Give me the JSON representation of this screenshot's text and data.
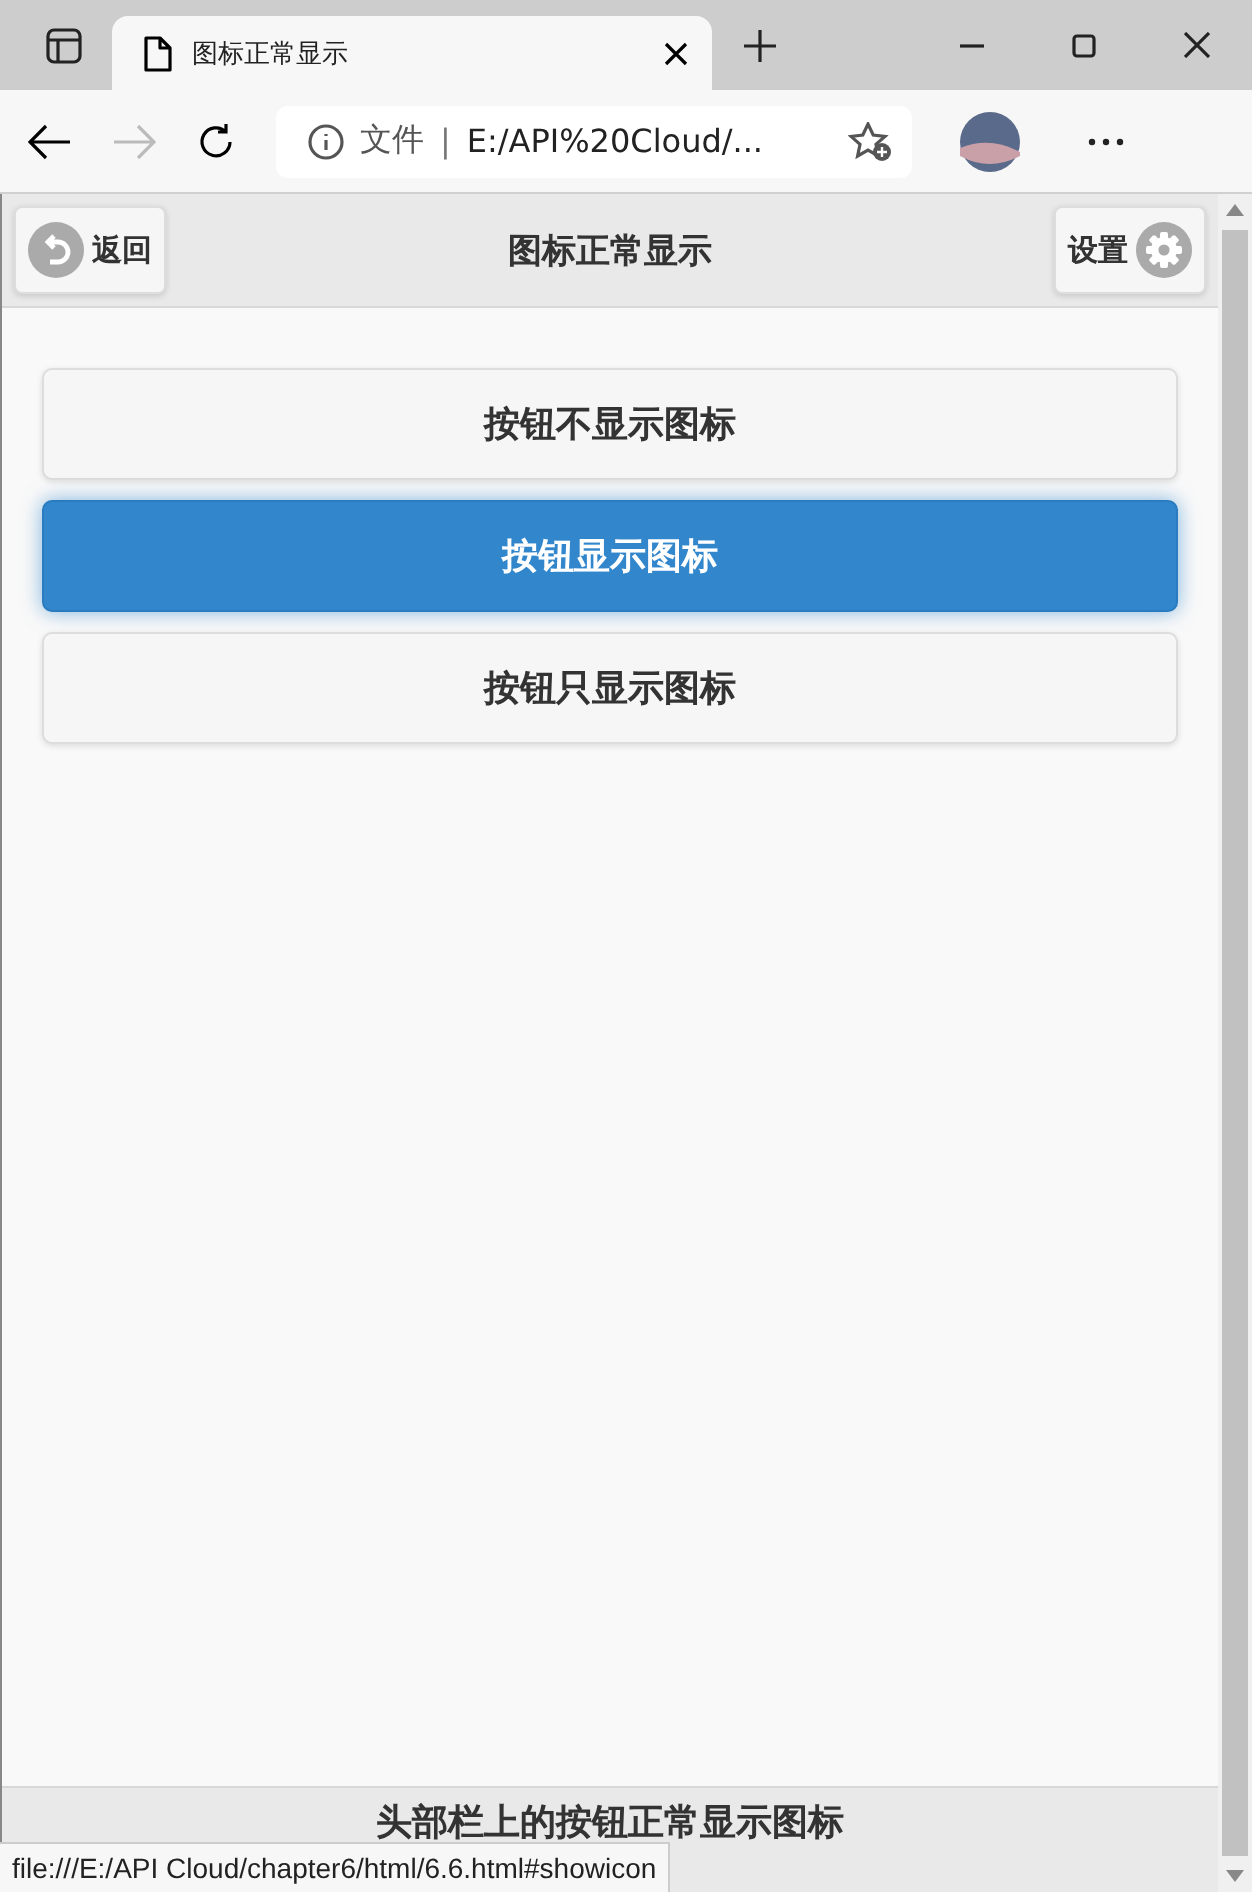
{
  "browser": {
    "tab_title": "图标正常显示",
    "address_prefix": "文件",
    "address_separator": "|",
    "address": "E:/API%20Cloud/..."
  },
  "header": {
    "back_button": "返回",
    "title": "图标正常显示",
    "settings_button": "设置"
  },
  "buttons": [
    {
      "label": "按钮不显示图标",
      "selected": false
    },
    {
      "label": "按钮显示图标",
      "selected": true
    },
    {
      "label": "按钮只显示图标",
      "selected": false
    }
  ],
  "footer": {
    "title": "头部栏上的按钮正常显示图标"
  },
  "status_bar": {
    "url": "file:///E:/API Cloud/chapter6/html/6.6.html#showicon"
  }
}
